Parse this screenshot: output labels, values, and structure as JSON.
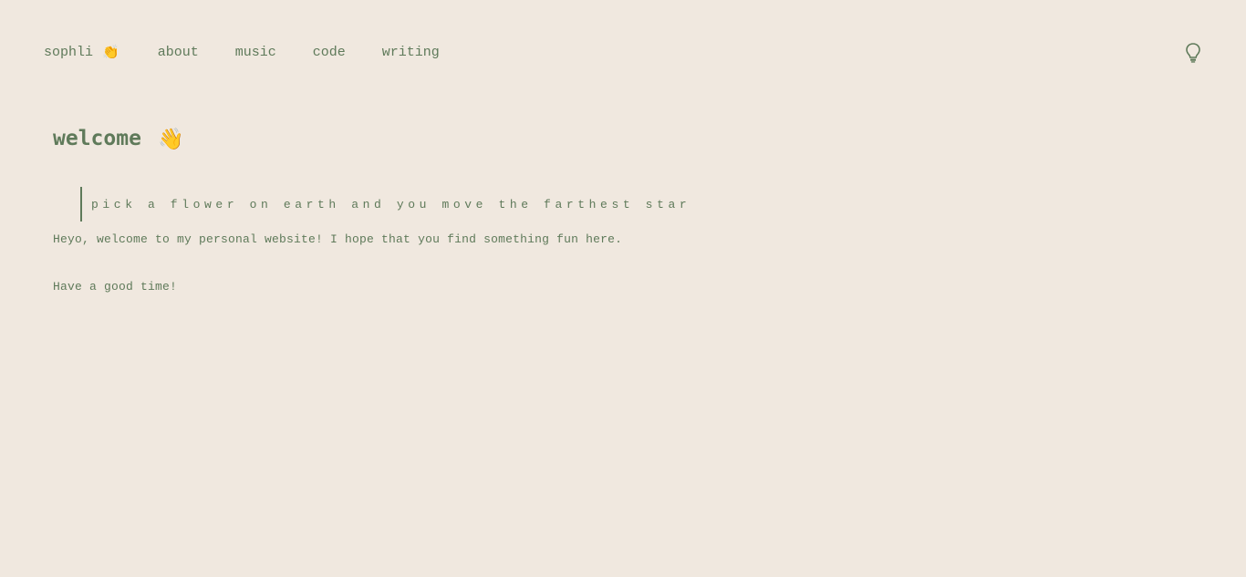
{
  "nav": {
    "brand": "sophli",
    "brand_emoji": "👏",
    "links": [
      "about",
      "music",
      "code",
      "writing"
    ]
  },
  "theme_toggle": {
    "icon": "lightbulb-icon"
  },
  "main": {
    "title": "welcome",
    "title_emoji": "👋",
    "quote": "pick a flower on earth and you move the farthest star",
    "paragraphs": [
      "Heyo, welcome to my personal website! I hope that you find something fun here.",
      "Have a good time!"
    ]
  },
  "colors": {
    "background": "#f0e8df",
    "accent": "#5f7a5a"
  }
}
